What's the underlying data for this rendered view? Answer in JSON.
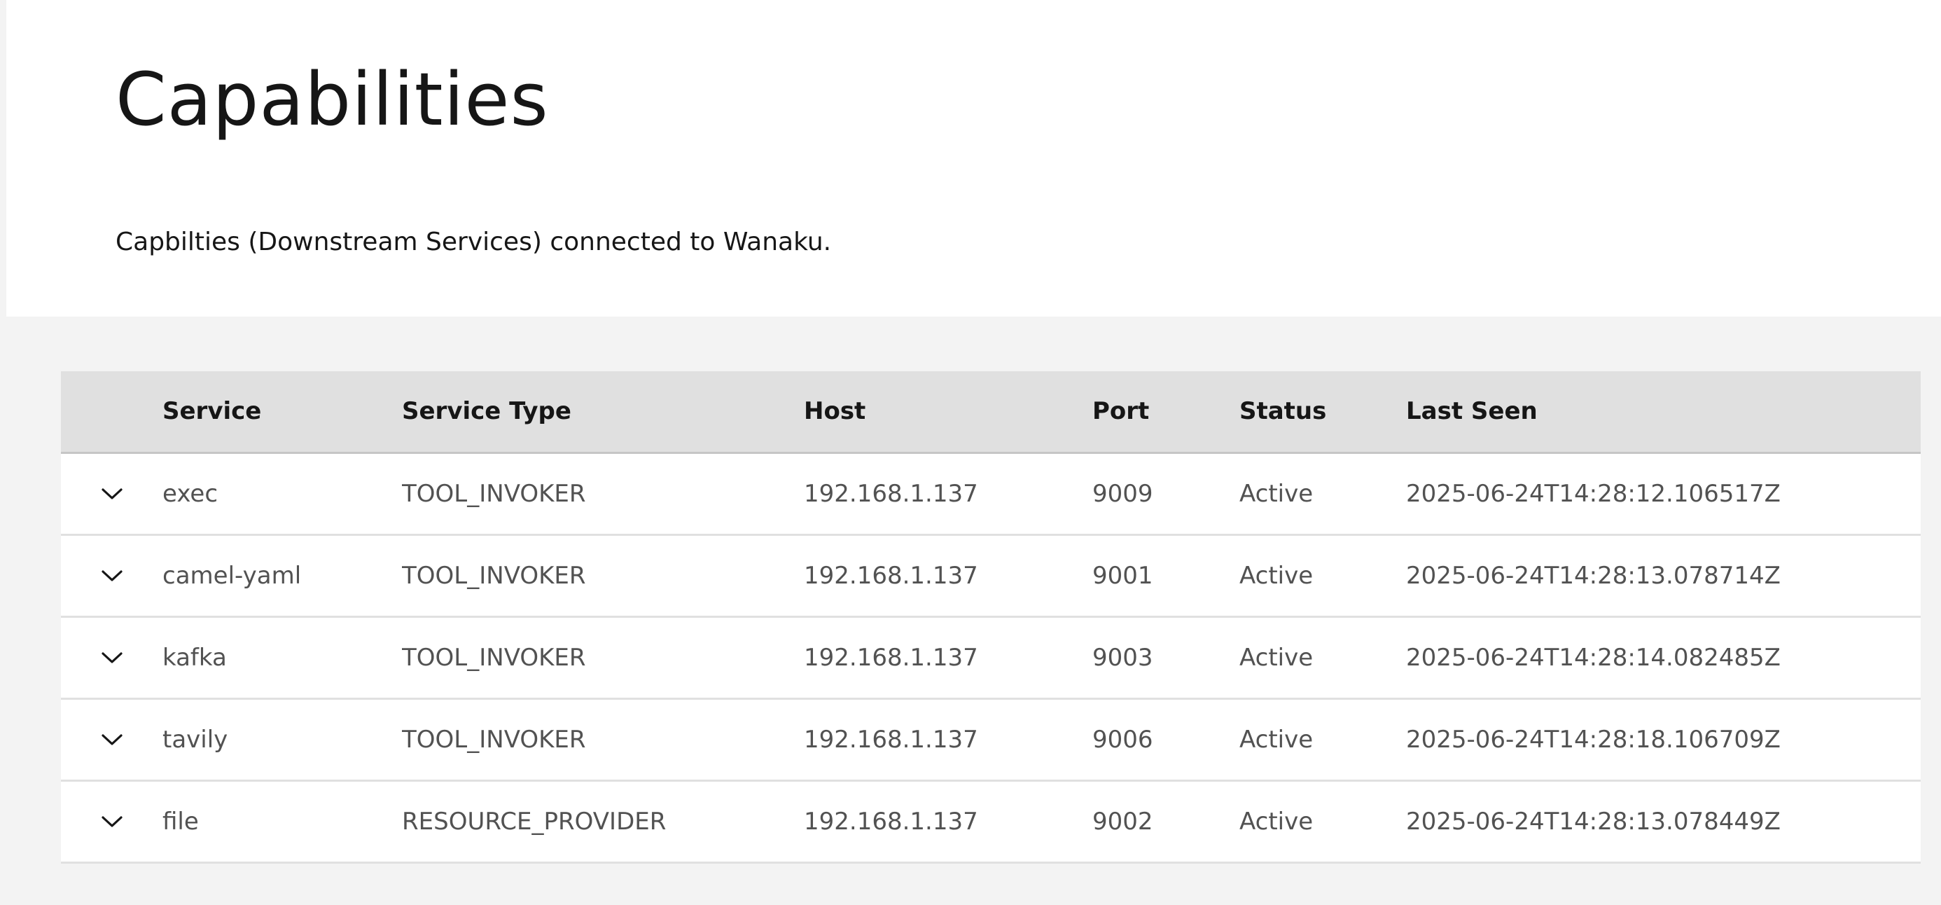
{
  "page": {
    "title": "Capabilities",
    "description": "Capbilties (Downstream Services) connected to Wanaku."
  },
  "table": {
    "headers": {
      "service": "Service",
      "service_type": "Service Type",
      "host": "Host",
      "port": "Port",
      "status": "Status",
      "last_seen": "Last Seen"
    },
    "rows": [
      {
        "service": "exec",
        "service_type": "TOOL_INVOKER",
        "host": "192.168.1.137",
        "port": "9009",
        "status": "Active",
        "last_seen": "2025-06-24T14:28:12.106517Z"
      },
      {
        "service": "camel-yaml",
        "service_type": "TOOL_INVOKER",
        "host": "192.168.1.137",
        "port": "9001",
        "status": "Active",
        "last_seen": "2025-06-24T14:28:13.078714Z"
      },
      {
        "service": "kafka",
        "service_type": "TOOL_INVOKER",
        "host": "192.168.1.137",
        "port": "9003",
        "status": "Active",
        "last_seen": "2025-06-24T14:28:14.082485Z"
      },
      {
        "service": "tavily",
        "service_type": "TOOL_INVOKER",
        "host": "192.168.1.137",
        "port": "9006",
        "status": "Active",
        "last_seen": "2025-06-24T14:28:18.106709Z"
      },
      {
        "service": "file",
        "service_type": "RESOURCE_PROVIDER",
        "host": "192.168.1.137",
        "port": "9002",
        "status": "Active",
        "last_seen": "2025-06-24T14:28:13.078449Z"
      }
    ],
    "row_icon": "chevron-down-icon"
  },
  "colors": {
    "page_background": "#f3f3f3",
    "panel_background": "#ffffff",
    "header_background": "#e0e0e0",
    "text_primary": "#161616",
    "text_secondary": "#525252"
  }
}
